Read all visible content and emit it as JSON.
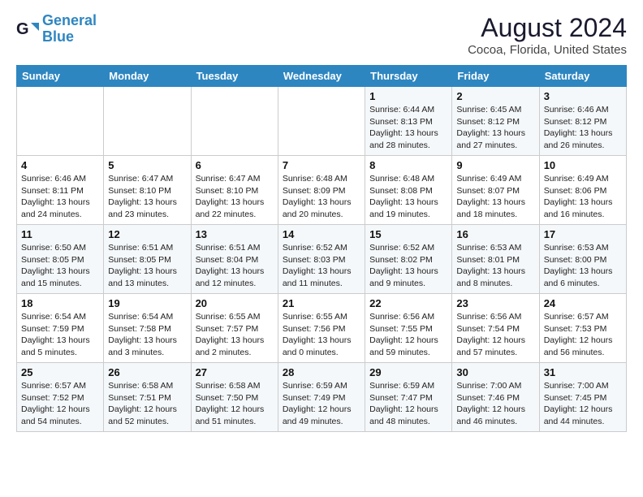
{
  "header": {
    "logo_line1": "General",
    "logo_line2": "Blue",
    "month_year": "August 2024",
    "location": "Cocoa, Florida, United States"
  },
  "weekdays": [
    "Sunday",
    "Monday",
    "Tuesday",
    "Wednesday",
    "Thursday",
    "Friday",
    "Saturday"
  ],
  "weeks": [
    [
      {
        "day": "",
        "info": ""
      },
      {
        "day": "",
        "info": ""
      },
      {
        "day": "",
        "info": ""
      },
      {
        "day": "",
        "info": ""
      },
      {
        "day": "1",
        "info": "Sunrise: 6:44 AM\nSunset: 8:13 PM\nDaylight: 13 hours\nand 28 minutes."
      },
      {
        "day": "2",
        "info": "Sunrise: 6:45 AM\nSunset: 8:12 PM\nDaylight: 13 hours\nand 27 minutes."
      },
      {
        "day": "3",
        "info": "Sunrise: 6:46 AM\nSunset: 8:12 PM\nDaylight: 13 hours\nand 26 minutes."
      }
    ],
    [
      {
        "day": "4",
        "info": "Sunrise: 6:46 AM\nSunset: 8:11 PM\nDaylight: 13 hours\nand 24 minutes."
      },
      {
        "day": "5",
        "info": "Sunrise: 6:47 AM\nSunset: 8:10 PM\nDaylight: 13 hours\nand 23 minutes."
      },
      {
        "day": "6",
        "info": "Sunrise: 6:47 AM\nSunset: 8:10 PM\nDaylight: 13 hours\nand 22 minutes."
      },
      {
        "day": "7",
        "info": "Sunrise: 6:48 AM\nSunset: 8:09 PM\nDaylight: 13 hours\nand 20 minutes."
      },
      {
        "day": "8",
        "info": "Sunrise: 6:48 AM\nSunset: 8:08 PM\nDaylight: 13 hours\nand 19 minutes."
      },
      {
        "day": "9",
        "info": "Sunrise: 6:49 AM\nSunset: 8:07 PM\nDaylight: 13 hours\nand 18 minutes."
      },
      {
        "day": "10",
        "info": "Sunrise: 6:49 AM\nSunset: 8:06 PM\nDaylight: 13 hours\nand 16 minutes."
      }
    ],
    [
      {
        "day": "11",
        "info": "Sunrise: 6:50 AM\nSunset: 8:05 PM\nDaylight: 13 hours\nand 15 minutes."
      },
      {
        "day": "12",
        "info": "Sunrise: 6:51 AM\nSunset: 8:05 PM\nDaylight: 13 hours\nand 13 minutes."
      },
      {
        "day": "13",
        "info": "Sunrise: 6:51 AM\nSunset: 8:04 PM\nDaylight: 13 hours\nand 12 minutes."
      },
      {
        "day": "14",
        "info": "Sunrise: 6:52 AM\nSunset: 8:03 PM\nDaylight: 13 hours\nand 11 minutes."
      },
      {
        "day": "15",
        "info": "Sunrise: 6:52 AM\nSunset: 8:02 PM\nDaylight: 13 hours\nand 9 minutes."
      },
      {
        "day": "16",
        "info": "Sunrise: 6:53 AM\nSunset: 8:01 PM\nDaylight: 13 hours\nand 8 minutes."
      },
      {
        "day": "17",
        "info": "Sunrise: 6:53 AM\nSunset: 8:00 PM\nDaylight: 13 hours\nand 6 minutes."
      }
    ],
    [
      {
        "day": "18",
        "info": "Sunrise: 6:54 AM\nSunset: 7:59 PM\nDaylight: 13 hours\nand 5 minutes."
      },
      {
        "day": "19",
        "info": "Sunrise: 6:54 AM\nSunset: 7:58 PM\nDaylight: 13 hours\nand 3 minutes."
      },
      {
        "day": "20",
        "info": "Sunrise: 6:55 AM\nSunset: 7:57 PM\nDaylight: 13 hours\nand 2 minutes."
      },
      {
        "day": "21",
        "info": "Sunrise: 6:55 AM\nSunset: 7:56 PM\nDaylight: 13 hours\nand 0 minutes."
      },
      {
        "day": "22",
        "info": "Sunrise: 6:56 AM\nSunset: 7:55 PM\nDaylight: 12 hours\nand 59 minutes."
      },
      {
        "day": "23",
        "info": "Sunrise: 6:56 AM\nSunset: 7:54 PM\nDaylight: 12 hours\nand 57 minutes."
      },
      {
        "day": "24",
        "info": "Sunrise: 6:57 AM\nSunset: 7:53 PM\nDaylight: 12 hours\nand 56 minutes."
      }
    ],
    [
      {
        "day": "25",
        "info": "Sunrise: 6:57 AM\nSunset: 7:52 PM\nDaylight: 12 hours\nand 54 minutes."
      },
      {
        "day": "26",
        "info": "Sunrise: 6:58 AM\nSunset: 7:51 PM\nDaylight: 12 hours\nand 52 minutes."
      },
      {
        "day": "27",
        "info": "Sunrise: 6:58 AM\nSunset: 7:50 PM\nDaylight: 12 hours\nand 51 minutes."
      },
      {
        "day": "28",
        "info": "Sunrise: 6:59 AM\nSunset: 7:49 PM\nDaylight: 12 hours\nand 49 minutes."
      },
      {
        "day": "29",
        "info": "Sunrise: 6:59 AM\nSunset: 7:47 PM\nDaylight: 12 hours\nand 48 minutes."
      },
      {
        "day": "30",
        "info": "Sunrise: 7:00 AM\nSunset: 7:46 PM\nDaylight: 12 hours\nand 46 minutes."
      },
      {
        "day": "31",
        "info": "Sunrise: 7:00 AM\nSunset: 7:45 PM\nDaylight: 12 hours\nand 44 minutes."
      }
    ]
  ]
}
